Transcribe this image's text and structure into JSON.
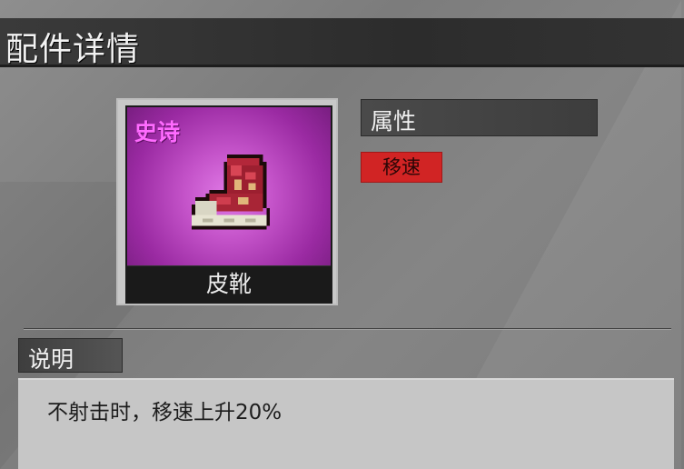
{
  "title": "配件详情",
  "item": {
    "rarity": "史诗",
    "name": "皮靴",
    "icon": "leather-boot-icon",
    "rarity_color": "#ff6bff"
  },
  "attributes": {
    "header": "属性",
    "tags": [
      "移速"
    ],
    "tag_color": "#d12424"
  },
  "description": {
    "header": "说明",
    "text": "不射击时，移速上升20%"
  }
}
